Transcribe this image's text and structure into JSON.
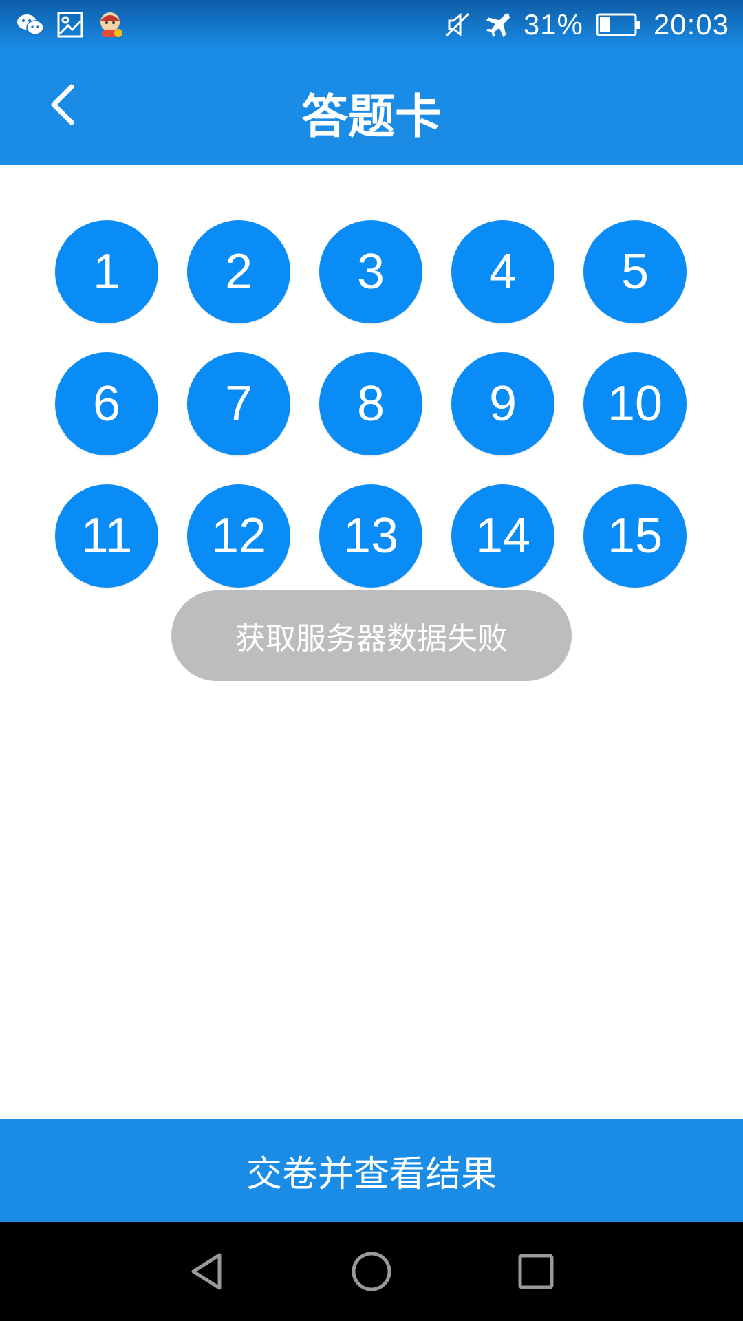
{
  "status_bar": {
    "icons_left": [
      "wechat-icon",
      "gallery-icon",
      "app-avatar-icon"
    ],
    "icons_right": [
      "mute-icon",
      "airplane-icon",
      "battery-icon"
    ],
    "battery": "31%",
    "time": "20:03"
  },
  "app_bar": {
    "title": "答题卡",
    "back_icon": "chevron-left-icon"
  },
  "questions": [
    "1",
    "2",
    "3",
    "4",
    "5",
    "6",
    "7",
    "8",
    "9",
    "10",
    "11",
    "12",
    "13",
    "14",
    "15"
  ],
  "colors": {
    "primary": "#1a8ce6",
    "circle": "#0a8cf6",
    "toast": "#bdbdbd"
  },
  "toast": {
    "message": "获取服务器数据失败"
  },
  "submit": {
    "label": "交卷并查看结果"
  },
  "nav_bar": {
    "buttons": [
      "back-triangle-icon",
      "home-circle-icon",
      "recents-square-icon"
    ]
  }
}
